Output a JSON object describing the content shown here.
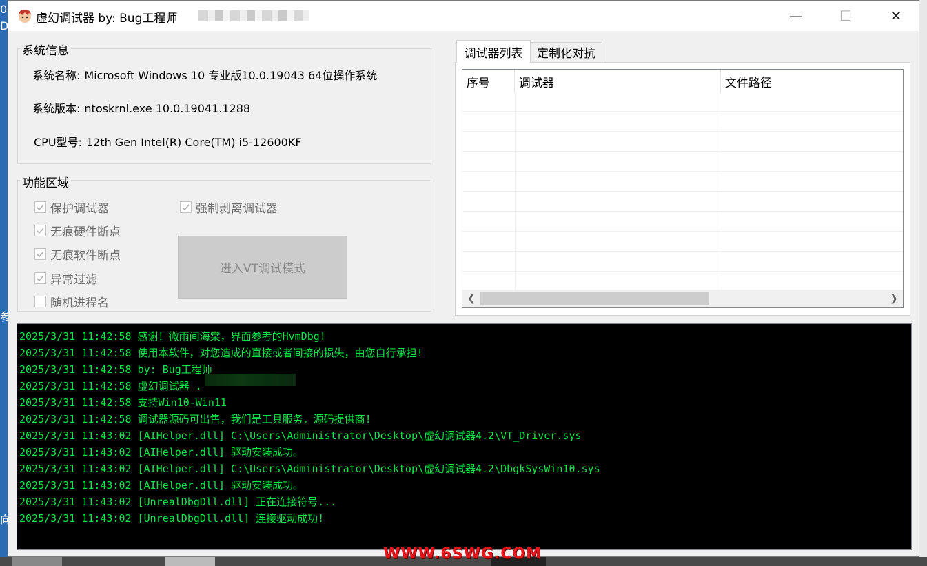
{
  "window": {
    "title": "虚幻调试器   by: Bug工程师",
    "minimize_glyph": "—",
    "maximize_glyph": "☐",
    "close_glyph": "✕"
  },
  "system_info": {
    "group_title": "系统信息",
    "name_label": "系统名称:",
    "name_value": "Microsoft Windows 10 专业版10.0.19043  64位操作系统",
    "version_label": "系统版本:",
    "version_value": "ntoskrnl.exe  10.0.19041.1288",
    "cpu_label": "CPU型号:",
    "cpu_value": "12th Gen Intel(R) Core(TM) i5-12600KF"
  },
  "function_area": {
    "group_title": "功能区域",
    "checkboxes": [
      {
        "label": "保护调试器",
        "checked": true
      },
      {
        "label": "无痕硬件断点",
        "checked": true
      },
      {
        "label": "无痕软件断点",
        "checked": true
      },
      {
        "label": "异常过滤",
        "checked": true
      },
      {
        "label": "随机进程名",
        "checked": false
      },
      {
        "label": "强制剥离调试器",
        "checked": true
      }
    ],
    "vt_button": "进入VT调试模式"
  },
  "tabs": [
    {
      "label": "调试器列表",
      "active": true
    },
    {
      "label": "定制化对抗",
      "active": false
    }
  ],
  "debugger_list": {
    "columns": [
      "序号",
      "调试器",
      "文件路径"
    ],
    "rows": []
  },
  "console": {
    "lines": [
      "2025/3/31 11:42:58 感谢！微雨间海棠，界面参考的HvmDbg!",
      "2025/3/31 11:42:58 使用本软件，对您造成的直接或者间接的损失，由您自行承担!",
      "2025/3/31 11:42:58 by: Bug工程师",
      "2025/3/31 11:42:58 虚幻调试器 .",
      "2025/3/31 11:42:58 支持Win10-Win11",
      "2025/3/31 11:42:58 调试器源码可出售，我们是工具服务，源码提供商!",
      "2025/3/31 11:43:02 [AIHelper.dll] C:\\Users\\Administrator\\Desktop\\虚幻调试器4.2\\VT_Driver.sys",
      "2025/3/31 11:43:02 [AIHelper.dll] 驱动安装成功。",
      "2025/3/31 11:43:02 [AIHelper.dll] C:\\Users\\Administrator\\Desktop\\虚幻调试器4.2\\DbgkSysWin10.sys",
      "2025/3/31 11:43:02 [AIHelper.dll] 驱动安装成功。",
      "2025/3/31 11:43:02 [UnrealDbgDll.dll] 正在连接符号...",
      "2025/3/31 11:43:02 [UnrealDbgDll.dll] 连接驱动成功!"
    ],
    "text_color": "#00e84a"
  },
  "watermark": "WWW.6SWG.COM",
  "desktop": {
    "edge_glyphs": [
      "0",
      "D",
      "参",
      "向"
    ]
  }
}
